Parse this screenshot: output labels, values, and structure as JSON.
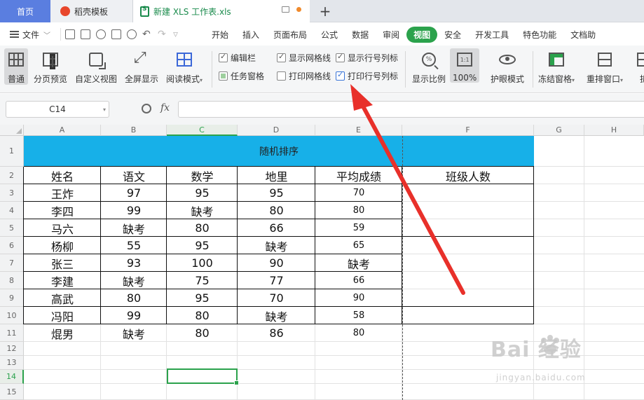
{
  "tabs": {
    "home": "首页",
    "template": "稻壳模板",
    "document": "新建 XLS 工作表.xls"
  },
  "menu": {
    "file": "文件",
    "items": [
      "开始",
      "插入",
      "页面布局",
      "公式",
      "数据",
      "审阅",
      "视图",
      "安全",
      "开发工具",
      "特色功能",
      "文档助"
    ],
    "active": "视图"
  },
  "ribbon": {
    "normal": "普通",
    "page_break_preview": "分页预览",
    "custom_view": "自定义视图",
    "full_screen": "全屏显示",
    "reading_mode": "阅读模式",
    "checkboxes": {
      "formula_bar": {
        "label": "编辑栏",
        "checked": true
      },
      "task_pane": {
        "label": "任务窗格",
        "checked": true
      },
      "show_gridlines": {
        "label": "显示网格线",
        "checked": true
      },
      "print_gridlines": {
        "label": "打印网格线",
        "checked": false
      },
      "show_headings": {
        "label": "显示行号列标",
        "checked": true
      },
      "print_headings": {
        "label": "打印行号列标",
        "checked": true
      }
    },
    "zoom": "显示比例",
    "zoom_100": "100%",
    "zoom_100_icon": "1:1",
    "zoom_icon_text": "%",
    "eye_protection": "护眼模式",
    "freeze_panes": "冻结窗格",
    "rearrange_windows": "重排窗口",
    "split": "拆"
  },
  "formula_bar": {
    "name_box": "C14",
    "fx": "fx",
    "formula": ""
  },
  "sheet": {
    "columns": [
      "A",
      "B",
      "C",
      "D",
      "E",
      "F",
      "G",
      "H"
    ],
    "rows": [
      "1",
      "2",
      "3",
      "4",
      "5",
      "6",
      "7",
      "8",
      "9",
      "10",
      "11",
      "12",
      "13",
      "14",
      "15"
    ],
    "title": "随机排序",
    "headers": [
      "姓名",
      "语文",
      "数学",
      "地里",
      "平均成绩",
      "班级人数"
    ],
    "data": [
      [
        "王炸",
        "97",
        "95",
        "95",
        "70"
      ],
      [
        "李四",
        "99",
        "缺考",
        "80",
        "80"
      ],
      [
        "马六",
        "缺考",
        "80",
        "66",
        "59"
      ],
      [
        "杨柳",
        "55",
        "95",
        "缺考",
        "65"
      ],
      [
        "张三",
        "93",
        "100",
        "90",
        "缺考"
      ],
      [
        "李建",
        "缺考",
        "75",
        "77",
        "66"
      ],
      [
        "高武",
        "80",
        "95",
        "70",
        "90"
      ],
      [
        "冯阳",
        "99",
        "80",
        "缺考",
        "58"
      ],
      [
        "焜男",
        "缺考",
        "80",
        "86",
        "80"
      ]
    ],
    "selected_cell": "C14"
  },
  "watermark": {
    "main": "Bai  经验",
    "sub": "jingyan.baidu.com"
  },
  "colors": {
    "accent_green": "#2ba24c",
    "title_fill": "#17b0e8",
    "arrow_red": "#e8302a",
    "home_tab": "#5a7ee0"
  },
  "icons": {
    "home_tab": "wps-home",
    "template_tab": "daoke-logo-icon",
    "doc_tab": "xls-file-icon",
    "new_tab": "plus-icon"
  }
}
